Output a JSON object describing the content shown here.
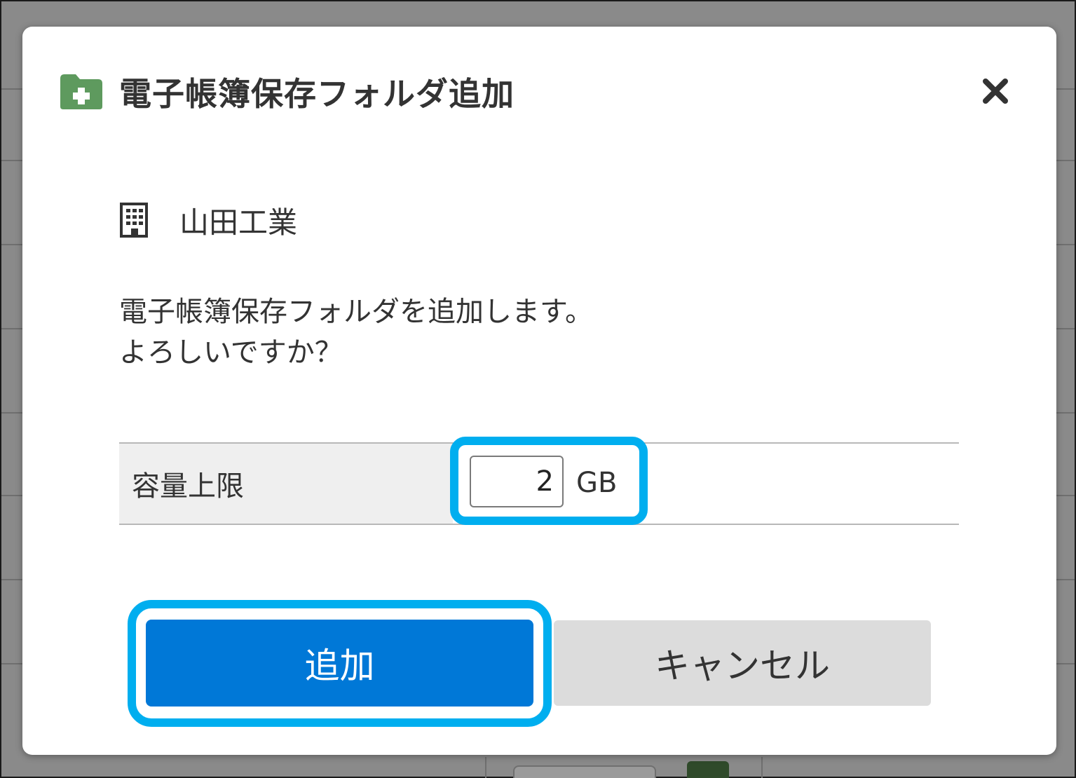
{
  "dialog": {
    "title": "電子帳簿保存フォルダ追加",
    "title_icon": "folder-plus-icon",
    "close_icon": "close-icon",
    "company_icon": "building-icon",
    "company_name": "山田工業",
    "message_line1": "電子帳簿保存フォルダを追加します。",
    "message_line2": "よろしいですか？",
    "capacity": {
      "label": "容量上限",
      "value": "2",
      "unit": "GB"
    },
    "buttons": {
      "add_label": "追加",
      "cancel_label": "キャンセル"
    }
  },
  "colors": {
    "primary": "#0078d7",
    "highlight": "#00aeef",
    "folder_green": "#5e9a5e",
    "cancel_bg": "#dcdcdc"
  }
}
